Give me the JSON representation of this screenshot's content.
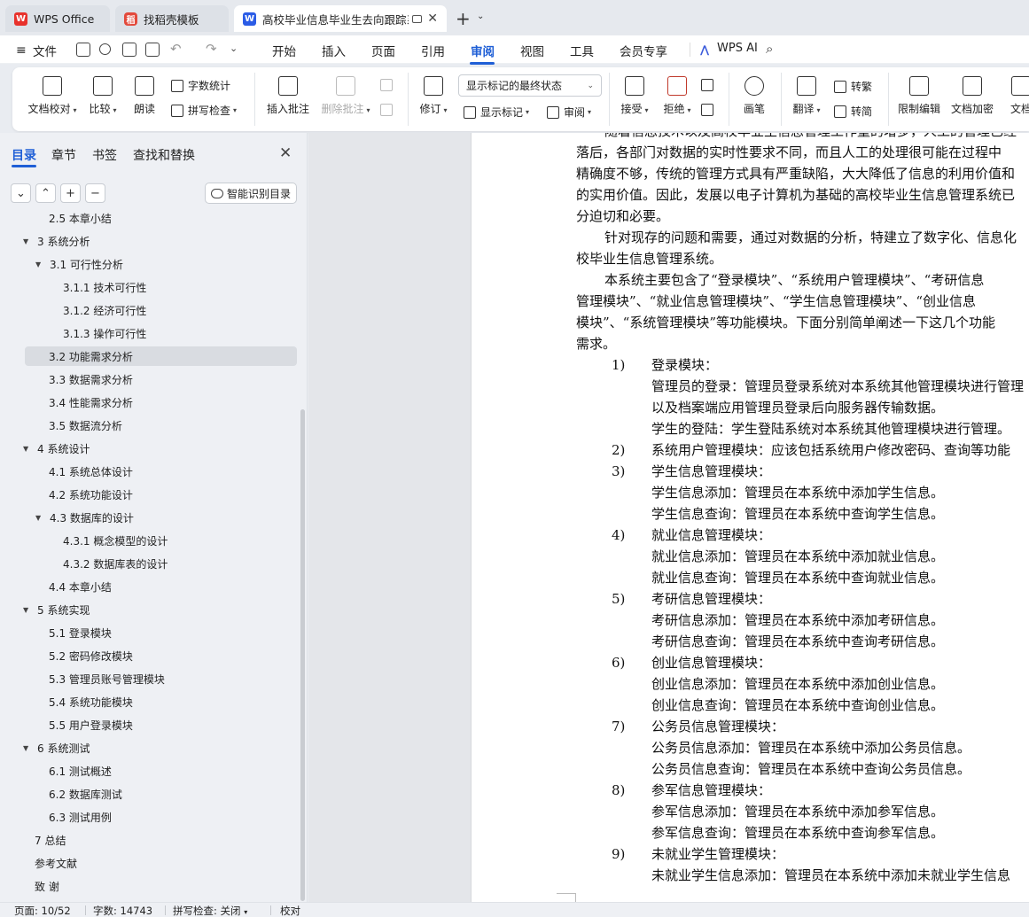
{
  "tabs": [
    {
      "label": "WPS Office",
      "icon": "wps-logo-icon"
    },
    {
      "label": "找稻壳模板",
      "icon": "docer-icon"
    },
    {
      "label": "高校毕业信息毕业生去向跟踪系",
      "icon": "writer-doc-icon"
    }
  ],
  "menu": {
    "file": "文件",
    "items": [
      "开始",
      "插入",
      "页面",
      "引用",
      "审阅",
      "视图",
      "工具",
      "会员专享"
    ],
    "active": "审阅",
    "ai": "WPS AI"
  },
  "ribbon": {
    "doc_check": "文档校对",
    "compare": "比较",
    "read_aloud": "朗读",
    "word_count": "字数统计",
    "spell_check": "拼写检查",
    "insert_comment": "插入批注",
    "delete_comment": "删除批注",
    "track_changes": "修订",
    "markup_dropdown": "显示标记的最终状态",
    "show_markup": "显示标记",
    "review": "审阅",
    "accept": "接受",
    "reject": "拒绝",
    "ink": "画笔",
    "translate": "翻译",
    "to_traditional": "转繁",
    "to_simplified": "转简",
    "restrict_edit": "限制编辑",
    "encrypt": "文档加密",
    "doc_more": "文档"
  },
  "nav": {
    "tabs": [
      "目录",
      "章节",
      "书签",
      "查找和替换"
    ],
    "active_tab": "目录",
    "smart_toc": "智能识别目录",
    "selected": "3.2  功能需求分析",
    "toc": [
      {
        "label": "2.5 本章小结",
        "level": 2,
        "collapsible": false
      },
      {
        "label": "3  系统分析",
        "level": 1,
        "collapsible": true
      },
      {
        "label": "3.1 可行性分析",
        "level": 2,
        "collapsible": true
      },
      {
        "label": "3.1.1  技术可行性",
        "level": 3,
        "collapsible": false
      },
      {
        "label": "3.1.2  经济可行性",
        "level": 3,
        "collapsible": false
      },
      {
        "label": "3.1.3  操作可行性",
        "level": 3,
        "collapsible": false
      },
      {
        "label": "3.2  功能需求分析",
        "level": 2,
        "collapsible": false
      },
      {
        "label": "3.3  数据需求分析",
        "level": 2,
        "collapsible": false
      },
      {
        "label": "3.4  性能需求分析",
        "level": 2,
        "collapsible": false
      },
      {
        "label": "3.5 数据流分析",
        "level": 2,
        "collapsible": false
      },
      {
        "label": "4    系统设计",
        "level": 1,
        "collapsible": true
      },
      {
        "label": "4.1 系统总体设计",
        "level": 2,
        "collapsible": false
      },
      {
        "label": "4.2 系统功能设计",
        "level": 2,
        "collapsible": false
      },
      {
        "label": "4.3  数据库的设计",
        "level": 2,
        "collapsible": true
      },
      {
        "label": "4.3.1  概念模型的设计",
        "level": 3,
        "collapsible": false
      },
      {
        "label": "4.3.2  数据库表的设计",
        "level": 3,
        "collapsible": false
      },
      {
        "label": "4.4 本章小结",
        "level": 2,
        "collapsible": false
      },
      {
        "label": "5    系统实现",
        "level": 1,
        "collapsible": true
      },
      {
        "label": "5.1 登录模块",
        "level": 2,
        "collapsible": false
      },
      {
        "label": "5.2 密码修改模块",
        "level": 2,
        "collapsible": false
      },
      {
        "label": "5.3 管理员账号管理模块",
        "level": 2,
        "collapsible": false
      },
      {
        "label": "5.4 系统功能模块",
        "level": 2,
        "collapsible": false
      },
      {
        "label": "5.5 用户登录模块",
        "level": 2,
        "collapsible": false
      },
      {
        "label": "6    系统测试",
        "level": 1,
        "collapsible": true
      },
      {
        "label": "6.1 测试概述",
        "level": 2,
        "collapsible": false
      },
      {
        "label": "6.2 数据库测试",
        "level": 2,
        "collapsible": false
      },
      {
        "label": "6.3 测试用例",
        "level": 2,
        "collapsible": false
      },
      {
        "label": "7    总结",
        "level": 1,
        "collapsible": false
      },
      {
        "label": "参考文献",
        "level": 1,
        "collapsible": false
      },
      {
        "label": "致  谢",
        "level": 1,
        "collapsible": false
      }
    ]
  },
  "document": {
    "lines": [
      {
        "text": "随着信息技术以及高校毕业生信息管理工作量的增多，人工的管理已经",
        "indent": 1
      },
      {
        "text": "落后，各部门对数据的实时性要求不同，而且人工的处理很可能在过程中",
        "indent": 0
      },
      {
        "text": "精确度不够，传统的管理方式具有严重缺陷，大大降低了信息的利用价值和",
        "indent": 0
      },
      {
        "text": "的实用价值。因此，发展以电子计算机为基础的高校毕业生信息管理系统已",
        "indent": 0
      },
      {
        "text": "分迫切和必要。",
        "indent": 0
      },
      {
        "text": "针对现存的问题和需要，通过对数据的分析，特建立了数字化、信息化",
        "indent": 1
      },
      {
        "text": "校毕业生信息管理系统。",
        "indent": 0
      },
      {
        "text": "本系统主要包含了“登录模块”、“系统用户管理模块”、“考研信息",
        "indent": 1
      },
      {
        "text": "管理模块”、“就业信息管理模块”、“学生信息管理模块”、“创业信息",
        "indent": 0
      },
      {
        "text": "模块”、“系统管理模块”等功能模块。下面分别简单阐述一下这几个功能",
        "indent": 0
      },
      {
        "text": "需求。",
        "indent": 0
      },
      {
        "num": "1)",
        "text": "登录模块："
      },
      {
        "text": "管理员的登录：管理员登录系统对本系统其他管理模块进行管理",
        "indent": 3
      },
      {
        "text": "以及档案端应用管理员登录后向服务器传输数据。",
        "indent": 3
      },
      {
        "text": " 学生的登陆：学生登陆系统对本系统其他管理模块进行管理。",
        "indent": 3
      },
      {
        "num": "2)",
        "text": "系统用户管理模块：应该包括系统用户修改密码、查询等功能"
      },
      {
        "num": "3)",
        "text": "学生信息管理模块："
      },
      {
        "text": "学生信息添加：管理员在本系统中添加学生信息。",
        "indent": 3
      },
      {
        "text": "学生信息查询：管理员在本系统中查询学生信息。",
        "indent": 3
      },
      {
        "num": "4)",
        "text": "就业信息管理模块："
      },
      {
        "text": "就业信息添加：管理员在本系统中添加就业信息。",
        "indent": 3
      },
      {
        "text": "就业信息查询：管理员在本系统中查询就业信息。",
        "indent": 3
      },
      {
        "num": "5)",
        "text": "考研信息管理模块："
      },
      {
        "text": "考研信息添加：管理员在本系统中添加考研信息。",
        "indent": 3
      },
      {
        "text": "考研信息查询：管理员在本系统中查询考研信息。",
        "indent": 3
      },
      {
        "num": "6)",
        "text": "创业信息管理模块："
      },
      {
        "text": "创业信息添加：管理员在本系统中添加创业信息。",
        "indent": 3
      },
      {
        "text": "创业信息查询：管理员在本系统中查询创业信息。",
        "indent": 3
      },
      {
        "num": "7)",
        "text": "公务员信息管理模块："
      },
      {
        "text": "公务员信息添加：管理员在本系统中添加公务员信息。",
        "indent": 3
      },
      {
        "text": "公务员信息查询：管理员在本系统中查询公务员信息。",
        "indent": 3
      },
      {
        "num": "8)",
        "text": "参军信息管理模块："
      },
      {
        "text": "参军信息添加：管理员在本系统中添加参军信息。",
        "indent": 3
      },
      {
        "text": "参军信息查询：管理员在本系统中查询参军信息。",
        "indent": 3
      },
      {
        "num": "9)",
        "text": "未就业学生管理模块："
      },
      {
        "text": "未就业学生信息添加：管理员在本系统中添加未就业学生信息",
        "indent": 3
      }
    ]
  },
  "status": {
    "page": "页面: 10/52",
    "words": "字数: 14743",
    "spell": "拼写检查: 关闭",
    "proof": "校对"
  },
  "colors": {
    "accent": "#1f5fd6",
    "wps_red": "#e8322c",
    "writer_blue": "#2b5ce6"
  }
}
